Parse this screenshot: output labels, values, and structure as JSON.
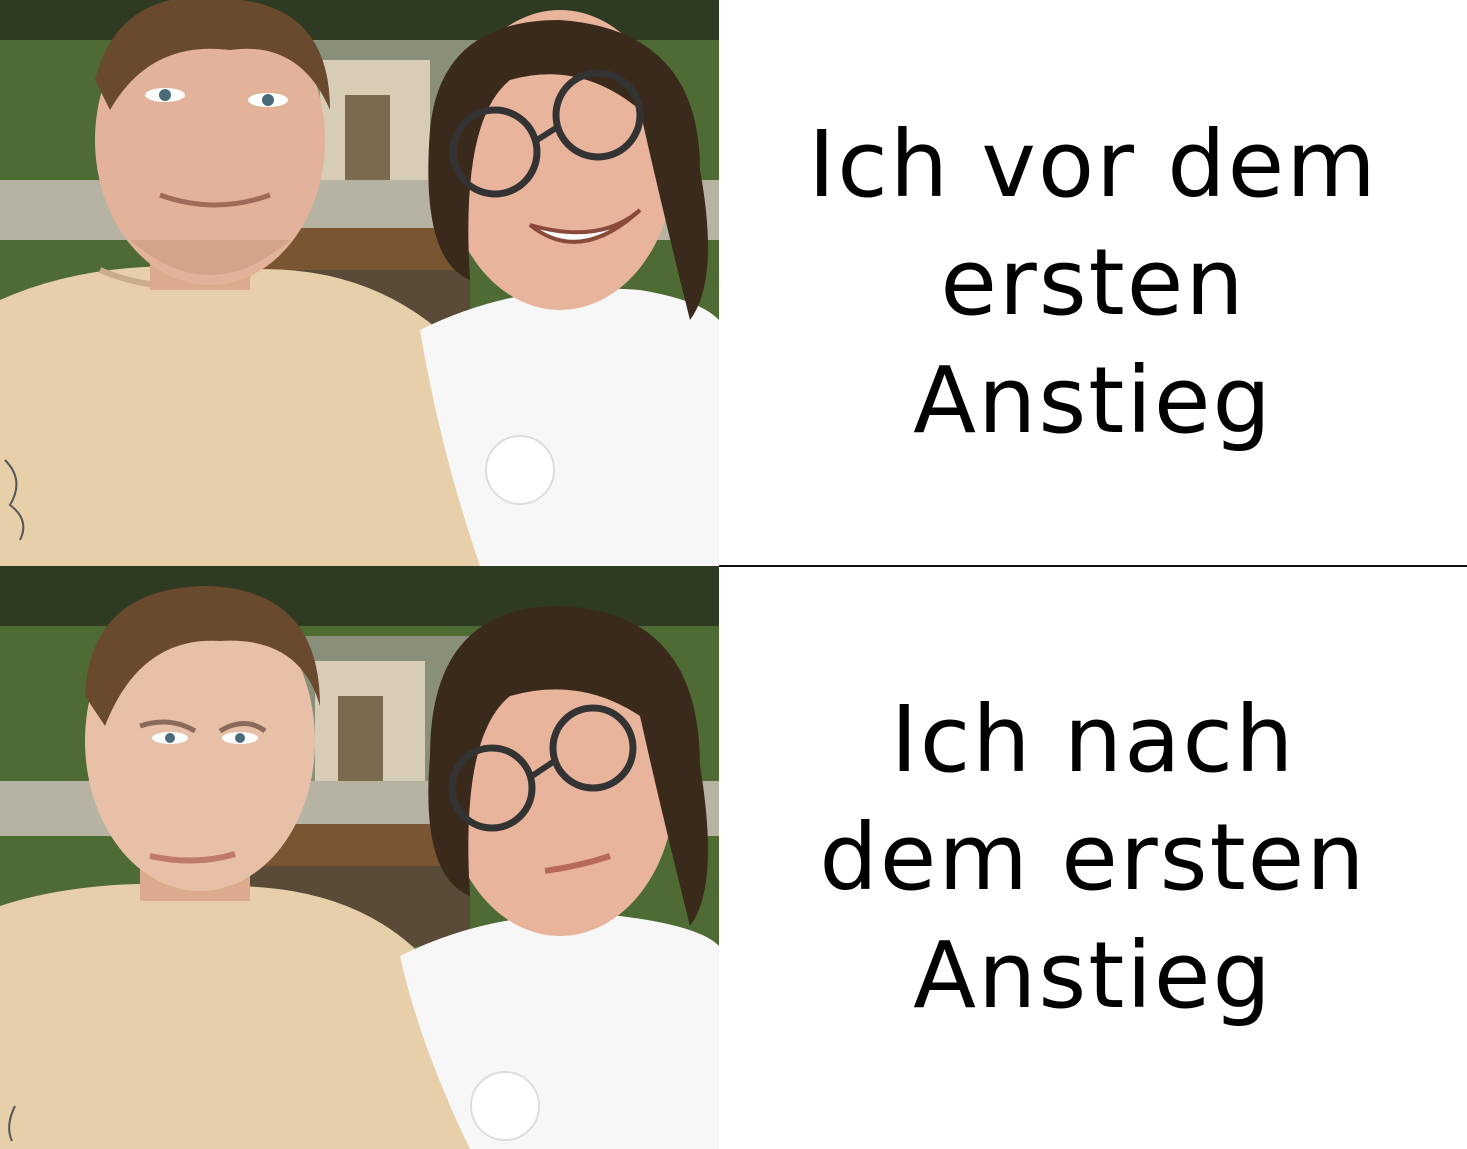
{
  "panels": [
    {
      "id": "top",
      "caption_lines": [
        "Ich vor dem",
        "ersten",
        "Anstieg"
      ],
      "mood": "smiling"
    },
    {
      "id": "bottom",
      "caption_lines": [
        "Ich nach",
        "dem ersten",
        "Anstieg"
      ],
      "mood": "exhausted"
    }
  ],
  "colors": {
    "background": "#ffffff",
    "text": "#000000",
    "divider": "#111111",
    "foliage": "#4e6b34",
    "shirt_left": "#e7cfaa",
    "shirt_right": "#f7f7f7",
    "skin": "#e3b29a",
    "hair_left": "#6a4a2e",
    "hair_right": "#3a2a1c"
  }
}
